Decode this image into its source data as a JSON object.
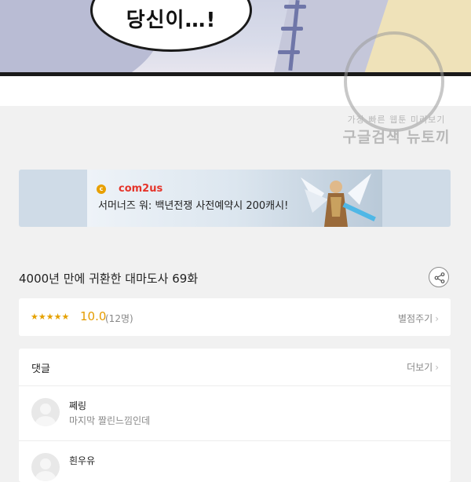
{
  "comic": {
    "bubble_text": "당신이…!"
  },
  "watermark": {
    "line1": "가장 빠른 웹툰 미리보기",
    "line2": "구글검색 뉴토끼"
  },
  "ad_banner": {
    "brand": "com2us",
    "text": "서머너즈 워: 백년전쟁 사전예약시 200캐시!"
  },
  "episode": {
    "title": "4000년 만에 귀환한 대마도사 69화"
  },
  "rating": {
    "stars": "★★★★★",
    "score": "10.0",
    "count": "(12명)",
    "rate_label": "별점주기"
  },
  "comments": {
    "header": "댓글",
    "more_label": "더보기",
    "items": [
      {
        "name": "쩨링",
        "text": "마지막 짤린느낌인데"
      },
      {
        "name": "흰우유",
        "text": ""
      }
    ]
  },
  "colors": {
    "accent": "#e59c00",
    "background": "#f1f1f1",
    "brand_red": "#e5352b"
  }
}
